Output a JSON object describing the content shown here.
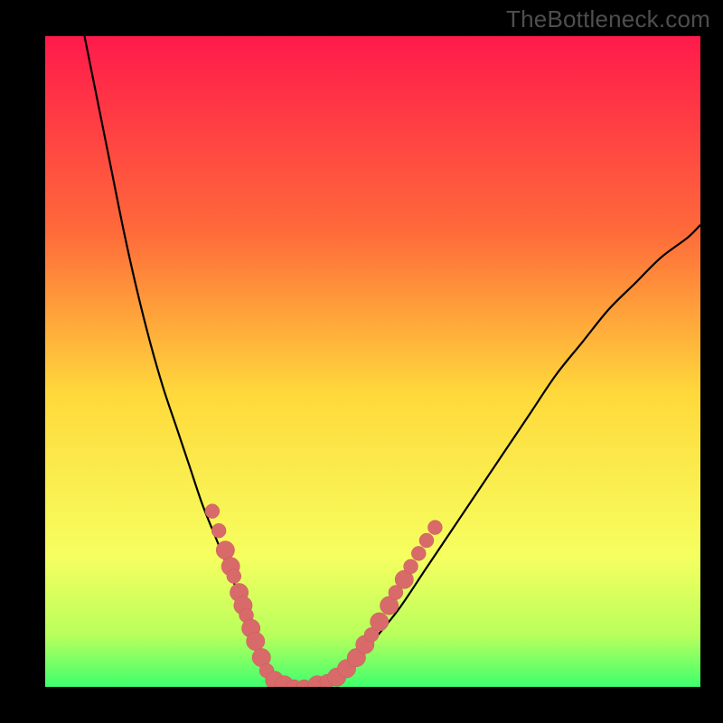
{
  "watermark": "TheBottleneck.com",
  "colors": {
    "frame": "#000000",
    "gradient_top": "#ff1a4b",
    "gradient_mid_upper": "#ff6a3a",
    "gradient_mid": "#ffd93b",
    "gradient_lower": "#f6ff60",
    "gradient_green1": "#b9ff5c",
    "gradient_green2": "#3fff6e",
    "curve": "#000000",
    "marker_fill": "#d96a6a",
    "marker_stroke": "#c95a5a"
  },
  "chart_data": {
    "type": "line",
    "title": "",
    "xlabel": "",
    "ylabel": "",
    "xlim": [
      0,
      100
    ],
    "ylim": [
      0,
      100
    ],
    "series": [
      {
        "name": "curve",
        "x": [
          6,
          8,
          10,
          12,
          14,
          16,
          18,
          20,
          22,
          24,
          26,
          28,
          30,
          32,
          33,
          34,
          36,
          38,
          42,
          46,
          50,
          54,
          58,
          62,
          66,
          70,
          74,
          78,
          82,
          86,
          90,
          94,
          98,
          100
        ],
        "y": [
          100,
          90,
          80,
          70,
          61,
          53,
          46,
          40,
          34,
          28,
          23,
          18,
          13,
          8,
          5,
          3,
          1,
          0,
          0,
          2,
          7,
          12,
          18,
          24,
          30,
          36,
          42,
          48,
          53,
          58,
          62,
          66,
          69,
          71
        ]
      }
    ],
    "markers": [
      {
        "x": 25.5,
        "y": 27,
        "r": 1.1
      },
      {
        "x": 26.5,
        "y": 24,
        "r": 1.1
      },
      {
        "x": 27.5,
        "y": 21,
        "r": 1.4
      },
      {
        "x": 28.3,
        "y": 18.5,
        "r": 1.4
      },
      {
        "x": 28.8,
        "y": 17,
        "r": 1.1
      },
      {
        "x": 29.6,
        "y": 14.5,
        "r": 1.4
      },
      {
        "x": 30.2,
        "y": 12.5,
        "r": 1.4
      },
      {
        "x": 30.7,
        "y": 11,
        "r": 1.1
      },
      {
        "x": 31.4,
        "y": 9,
        "r": 1.4
      },
      {
        "x": 32.1,
        "y": 7,
        "r": 1.4
      },
      {
        "x": 33.0,
        "y": 4.5,
        "r": 1.4
      },
      {
        "x": 33.8,
        "y": 2.5,
        "r": 1.1
      },
      {
        "x": 35.0,
        "y": 1.0,
        "r": 1.4
      },
      {
        "x": 36.5,
        "y": 0.3,
        "r": 1.4
      },
      {
        "x": 38.0,
        "y": 0.0,
        "r": 1.1
      },
      {
        "x": 39.5,
        "y": 0.0,
        "r": 1.1
      },
      {
        "x": 41.5,
        "y": 0.3,
        "r": 1.4
      },
      {
        "x": 43.0,
        "y": 0.8,
        "r": 1.1
      },
      {
        "x": 44.5,
        "y": 1.5,
        "r": 1.4
      },
      {
        "x": 46.0,
        "y": 2.8,
        "r": 1.4
      },
      {
        "x": 47.5,
        "y": 4.5,
        "r": 1.4
      },
      {
        "x": 48.8,
        "y": 6.5,
        "r": 1.4
      },
      {
        "x": 49.8,
        "y": 8.0,
        "r": 1.1
      },
      {
        "x": 51.0,
        "y": 10.0,
        "r": 1.4
      },
      {
        "x": 52.5,
        "y": 12.5,
        "r": 1.4
      },
      {
        "x": 53.5,
        "y": 14.5,
        "r": 1.1
      },
      {
        "x": 54.8,
        "y": 16.5,
        "r": 1.4
      },
      {
        "x": 55.8,
        "y": 18.5,
        "r": 1.1
      },
      {
        "x": 57.0,
        "y": 20.5,
        "r": 1.1
      },
      {
        "x": 58.2,
        "y": 22.5,
        "r": 1.1
      },
      {
        "x": 59.5,
        "y": 24.5,
        "r": 1.1
      }
    ]
  }
}
